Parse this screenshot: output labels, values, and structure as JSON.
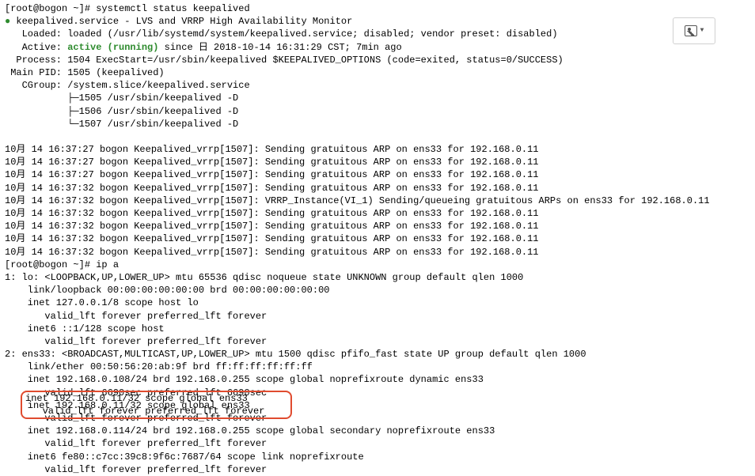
{
  "status_cmd": {
    "prompt": "[root@bogon ~]# systemctl status keepalived",
    "service_header": "keepalived.service - LVS and VRRP High Availability Monitor",
    "loaded": "   Loaded: loaded (/usr/lib/systemd/system/keepalived.service; disabled; vendor preset: disabled)",
    "active_label": "   Active: ",
    "active_state": "active (running)",
    "active_since": " since 日 2018-10-14 16:31:29 CST; 7min ago",
    "process": "  Process: 1504 ExecStart=/usr/sbin/keepalived $KEEPALIVED_OPTIONS (code=exited, status=0/SUCCESS)",
    "main_pid": " Main PID: 1505 (keepalived)",
    "cgroup": "   CGroup: /system.slice/keepalived.service",
    "cgroup_lines": [
      "           ├─1505 /usr/sbin/keepalived -D",
      "           ├─1506 /usr/sbin/keepalived -D",
      "           └─1507 /usr/sbin/keepalived -D"
    ],
    "log_lines": [
      "10月 14 16:37:27 bogon Keepalived_vrrp[1507]: Sending gratuitous ARP on ens33 for 192.168.0.11",
      "10月 14 16:37:27 bogon Keepalived_vrrp[1507]: Sending gratuitous ARP on ens33 for 192.168.0.11",
      "10月 14 16:37:27 bogon Keepalived_vrrp[1507]: Sending gratuitous ARP on ens33 for 192.168.0.11",
      "10月 14 16:37:32 bogon Keepalived_vrrp[1507]: Sending gratuitous ARP on ens33 for 192.168.0.11",
      "10月 14 16:37:32 bogon Keepalived_vrrp[1507]: VRRP_Instance(VI_1) Sending/queueing gratuitous ARPs on ens33 for 192.168.0.11",
      "10月 14 16:37:32 bogon Keepalived_vrrp[1507]: Sending gratuitous ARP on ens33 for 192.168.0.11",
      "10月 14 16:37:32 bogon Keepalived_vrrp[1507]: Sending gratuitous ARP on ens33 for 192.168.0.11",
      "10月 14 16:37:32 bogon Keepalived_vrrp[1507]: Sending gratuitous ARP on ens33 for 192.168.0.11",
      "10月 14 16:37:32 bogon Keepalived_vrrp[1507]: Sending gratuitous ARP on ens33 for 192.168.0.11"
    ]
  },
  "ip_cmd": {
    "prompt": "[root@bogon ~]# ip a",
    "lines": [
      "1: lo: <LOOPBACK,UP,LOWER_UP> mtu 65536 qdisc noqueue state UNKNOWN group default qlen 1000",
      "    link/loopback 00:00:00:00:00:00 brd 00:00:00:00:00:00",
      "    inet 127.0.0.1/8 scope host lo",
      "       valid_lft forever preferred_lft forever",
      "    inet6 ::1/128 scope host",
      "       valid_lft forever preferred_lft forever",
      "2: ens33: <BROADCAST,MULTICAST,UP,LOWER_UP> mtu 1500 qdisc pfifo_fast state UP group default qlen 1000",
      "    link/ether 00:50:56:20:ab:9f brd ff:ff:ff:ff:ff:ff",
      "    inet 192.168.0.108/24 brd 192.168.0.255 scope global noprefixroute dynamic ens33",
      "       valid_lft 6690sec preferred_lft 6690sec",
      "    inet 192.168.0.11/32 scope global ens33",
      "       valid_lft forever preferred_lft forever",
      "    inet 192.168.0.114/24 brd 192.168.0.255 scope global secondary noprefixroute ens33",
      "       valid_lft forever preferred_lft forever",
      "    inet6 fe80::c7cc:39c8:9f6c:7687/64 scope link noprefixroute",
      "       valid_lft forever preferred_lft forever"
    ]
  },
  "highlight_text_line1": "inet 192.168.0.11/32 scope global ens33       ",
  "highlight_text_line2": "   valid_lft forever preferred_lft forever    "
}
